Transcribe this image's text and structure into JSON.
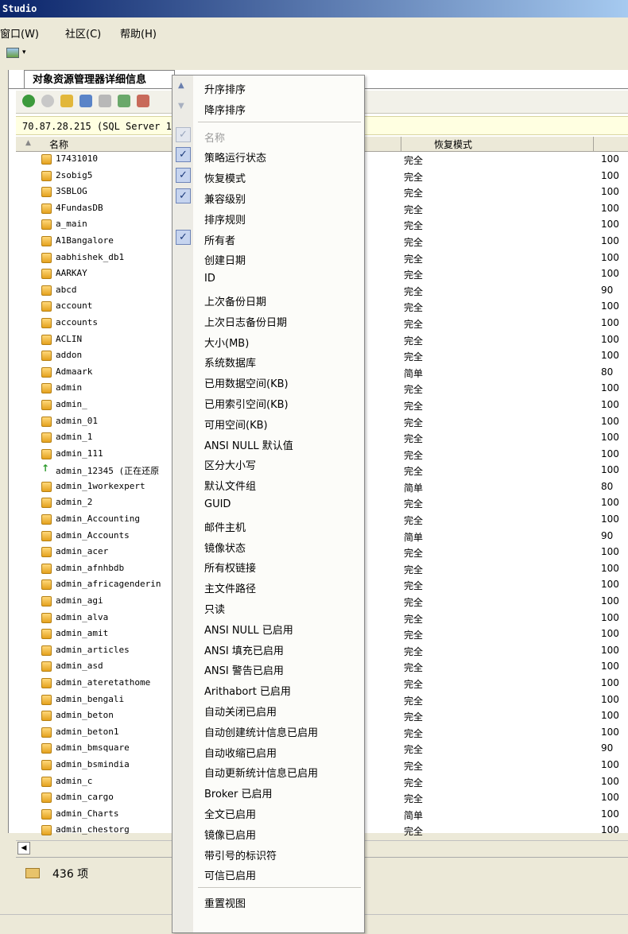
{
  "window": {
    "title": "Studio"
  },
  "menubar": {
    "items": [
      "窗口(W)",
      "社区(C)",
      "帮助(H)"
    ]
  },
  "tab": {
    "label": "对象资源管理器详细信息"
  },
  "connection": {
    "text": "70.87.28.215 (SQL Server 1"
  },
  "columns": {
    "name": "名称",
    "recovery": "恢复模式"
  },
  "rows": [
    {
      "name": "17431010",
      "recovery": "完全",
      "compat": "100"
    },
    {
      "name": "2sobig5",
      "recovery": "完全",
      "compat": "100"
    },
    {
      "name": "3SBLOG",
      "recovery": "完全",
      "compat": "100"
    },
    {
      "name": "4FundasDB",
      "recovery": "完全",
      "compat": "100"
    },
    {
      "name": "a_main",
      "recovery": "完全",
      "compat": "100"
    },
    {
      "name": "A1Bangalore",
      "recovery": "完全",
      "compat": "100"
    },
    {
      "name": "aabhishek_db1",
      "recovery": "完全",
      "compat": "100"
    },
    {
      "name": "AARKAY",
      "recovery": "完全",
      "compat": "100"
    },
    {
      "name": "abcd",
      "recovery": "完全",
      "compat": "90"
    },
    {
      "name": "account",
      "recovery": "完全",
      "compat": "100"
    },
    {
      "name": "accounts",
      "recovery": "完全",
      "compat": "100"
    },
    {
      "name": "ACLIN",
      "recovery": "完全",
      "compat": "100"
    },
    {
      "name": "addon",
      "recovery": "完全",
      "compat": "100"
    },
    {
      "name": "Admaark",
      "recovery": "简单",
      "compat": "80"
    },
    {
      "name": "admin",
      "recovery": "完全",
      "compat": "100"
    },
    {
      "name": "admin_",
      "recovery": "完全",
      "compat": "100"
    },
    {
      "name": "admin_01",
      "recovery": "完全",
      "compat": "100"
    },
    {
      "name": "admin_1",
      "recovery": "完全",
      "compat": "100"
    },
    {
      "name": "admin_111",
      "recovery": "完全",
      "compat": "100"
    },
    {
      "name": "admin_12345 (正在还原",
      "recovery": "完全",
      "compat": "100",
      "restoring": true
    },
    {
      "name": "admin_1workexpert",
      "recovery": "简单",
      "compat": "80"
    },
    {
      "name": "admin_2",
      "recovery": "完全",
      "compat": "100"
    },
    {
      "name": "admin_Accounting",
      "recovery": "完全",
      "compat": "100"
    },
    {
      "name": "admin_Accounts",
      "recovery": "简单",
      "compat": "90"
    },
    {
      "name": "admin_acer",
      "recovery": "完全",
      "compat": "100"
    },
    {
      "name": "admin_afnhbdb",
      "recovery": "完全",
      "compat": "100"
    },
    {
      "name": "admin_africagenderin",
      "recovery": "完全",
      "compat": "100"
    },
    {
      "name": "admin_agi",
      "recovery": "完全",
      "compat": "100"
    },
    {
      "name": "admin_alva",
      "recovery": "完全",
      "compat": "100"
    },
    {
      "name": "admin_amit",
      "recovery": "完全",
      "compat": "100"
    },
    {
      "name": "admin_articles",
      "recovery": "完全",
      "compat": "100"
    },
    {
      "name": "admin_asd",
      "recovery": "完全",
      "compat": "100"
    },
    {
      "name": "admin_ateretathome",
      "recovery": "完全",
      "compat": "100"
    },
    {
      "name": "admin_bengali",
      "recovery": "完全",
      "compat": "100"
    },
    {
      "name": "admin_beton",
      "recovery": "完全",
      "compat": "100"
    },
    {
      "name": "admin_beton1",
      "recovery": "完全",
      "compat": "100"
    },
    {
      "name": "admin_bmsquare",
      "recovery": "完全",
      "compat": "90"
    },
    {
      "name": "admin_bsmindia",
      "recovery": "完全",
      "compat": "100"
    },
    {
      "name": "admin_c",
      "recovery": "完全",
      "compat": "100"
    },
    {
      "name": "admin_cargo",
      "recovery": "完全",
      "compat": "100"
    },
    {
      "name": "admin_Charts",
      "recovery": "简单",
      "compat": "100"
    },
    {
      "name": "admin_chestorg",
      "recovery": "完全",
      "compat": "100"
    }
  ],
  "status": {
    "count": "436 项"
  },
  "context_menu": {
    "items": [
      {
        "label": "升序排序",
        "kind": "sort-asc"
      },
      {
        "label": "降序排序",
        "kind": "sort-desc"
      },
      {
        "sep": true
      },
      {
        "label": "名称",
        "checked": true,
        "disabled": true
      },
      {
        "label": "策略运行状态",
        "checked": true
      },
      {
        "label": "恢复模式",
        "checked": true
      },
      {
        "label": "兼容级别",
        "checked": true
      },
      {
        "label": "排序规则"
      },
      {
        "label": "所有者",
        "checked": true
      },
      {
        "label": "创建日期"
      },
      {
        "label": "ID"
      },
      {
        "label": "上次备份日期"
      },
      {
        "label": "上次日志备份日期"
      },
      {
        "label": "大小(MB)"
      },
      {
        "label": "系统数据库"
      },
      {
        "label": "已用数据空间(KB)"
      },
      {
        "label": "已用索引空间(KB)"
      },
      {
        "label": "可用空间(KB)"
      },
      {
        "label": "ANSI NULL 默认值"
      },
      {
        "label": "区分大小写"
      },
      {
        "label": "默认文件组"
      },
      {
        "label": "GUID"
      },
      {
        "label": "邮件主机"
      },
      {
        "label": "镜像状态"
      },
      {
        "label": "所有权链接"
      },
      {
        "label": "主文件路径"
      },
      {
        "label": "只读"
      },
      {
        "label": "ANSI NULL 已启用"
      },
      {
        "label": "ANSI 填充已启用"
      },
      {
        "label": "ANSI 警告已启用"
      },
      {
        "label": "Arithabort 已启用"
      },
      {
        "label": "自动关闭已启用"
      },
      {
        "label": "自动创建统计信息已启用"
      },
      {
        "label": "自动收缩已启用"
      },
      {
        "label": "自动更新统计信息已启用"
      },
      {
        "label": "Broker 已启用"
      },
      {
        "label": "全文已启用"
      },
      {
        "label": "镜像已启用"
      },
      {
        "label": "带引号的标识符"
      },
      {
        "label": "可信已启用"
      },
      {
        "sep": true
      },
      {
        "label": "重置视图"
      }
    ]
  }
}
